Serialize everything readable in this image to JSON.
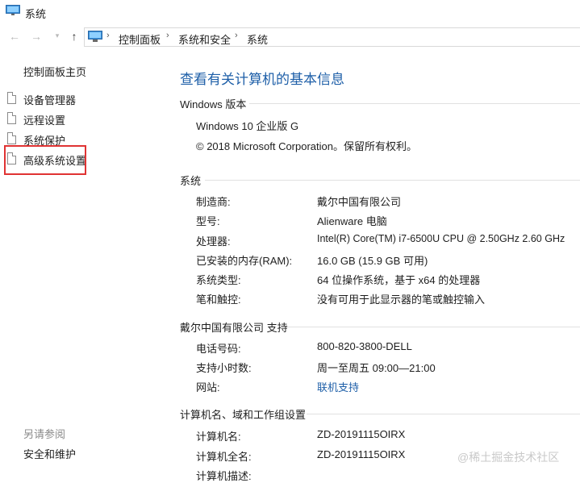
{
  "window": {
    "title": "系统"
  },
  "address": {
    "crumbs": [
      "控制面板",
      "系统和安全",
      "系统"
    ]
  },
  "left_pane": {
    "home_link": "控制面板主页",
    "tasks": [
      "设备管理器",
      "远程设置",
      "系统保护",
      "高级系统设置"
    ],
    "highlighted_task": "高级系统设置",
    "highlight_color": "#e03333",
    "see_also_title": "另请参阅",
    "see_also_link": "安全和维护"
  },
  "main": {
    "title": "查看有关计算机的基本信息",
    "windows_edition": {
      "heading": "Windows 版本",
      "edition": "Windows 10 企业版 G",
      "copyright": "© 2018 Microsoft Corporation。保留所有权利。"
    },
    "system": {
      "heading": "系统",
      "rows": [
        {
          "label": "制造商:",
          "value": "戴尔中国有限公司"
        },
        {
          "label": "型号:",
          "value": "Alienware 电脑"
        },
        {
          "label": "处理器:",
          "value": "Intel(R) Core(TM) i7-6500U CPU @ 2.50GHz   2.60 GHz"
        },
        {
          "label": "已安装的内存(RAM):",
          "value": "16.0 GB (15.9 GB 可用)"
        },
        {
          "label": "系统类型:",
          "value": "64 位操作系统，基于 x64 的处理器"
        },
        {
          "label": "笔和触控:",
          "value": "没有可用于此显示器的笔或触控输入"
        }
      ]
    },
    "support": {
      "heading": "戴尔中国有限公司 支持",
      "rows": [
        {
          "label": "电话号码:",
          "value": "800-820-3800-DELL"
        },
        {
          "label": "支持小时数:",
          "value": "周一至周五 09:00—21:00"
        },
        {
          "label": "网站:",
          "value": "联机支持"
        }
      ]
    },
    "computer": {
      "heading": "计算机名、域和工作组设置",
      "rows": [
        {
          "label": "计算机名:",
          "value": "ZD-20191115OIRX"
        },
        {
          "label": "计算机全名:",
          "value": "ZD-20191115OIRX"
        },
        {
          "label": "计算机描述:",
          "value": ""
        }
      ]
    }
  },
  "watermark": "@稀土掘金技术社区",
  "colors": {
    "accent": "#1e5fa8",
    "link": "#1e5fa8"
  }
}
